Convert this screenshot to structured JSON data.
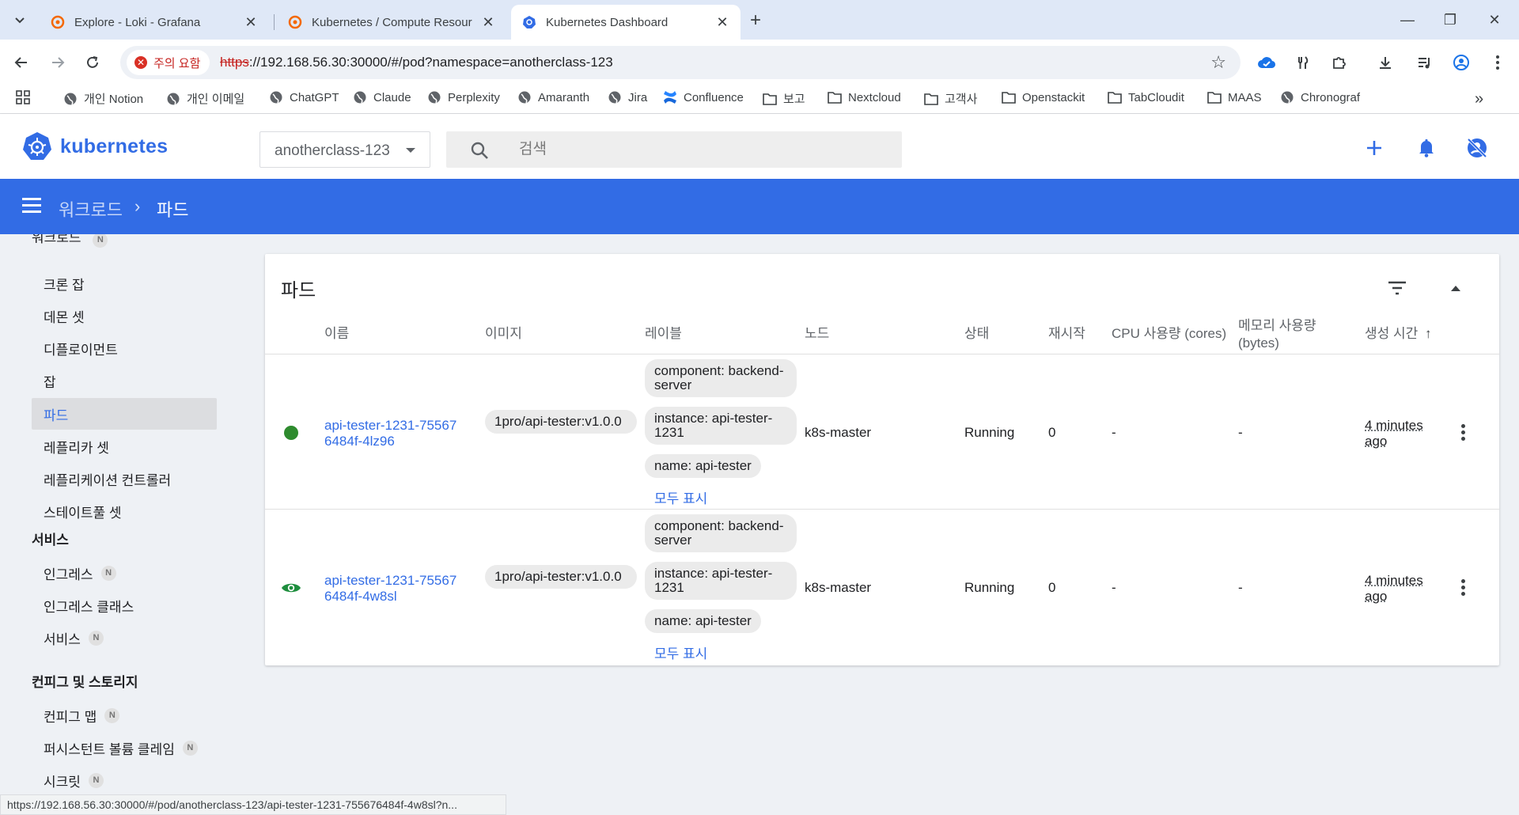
{
  "browser": {
    "tabs": [
      {
        "title": "Explore - Loki - Grafana",
        "active": false
      },
      {
        "title": "Kubernetes / Compute Resour",
        "active": false
      },
      {
        "title": "Kubernetes Dashboard",
        "active": true
      }
    ],
    "address": {
      "security_chip": "주의 요함",
      "url_scheme": "https",
      "url_rest": "://192.168.56.30:30000/#/pod?namespace=anotherclass-123"
    },
    "bookmarks": [
      {
        "label": "개인 Notion",
        "icon": "globe-icon"
      },
      {
        "label": "개인 이메일",
        "icon": "globe-icon"
      },
      {
        "label": "ChatGPT",
        "icon": "globe-icon"
      },
      {
        "label": "Claude",
        "icon": "globe-icon"
      },
      {
        "label": "Perplexity",
        "icon": "globe-icon"
      },
      {
        "label": "Amaranth",
        "icon": "globe-icon"
      },
      {
        "label": "Jira",
        "icon": "globe-icon"
      },
      {
        "label": "Confluence",
        "icon": "confluence-icon"
      },
      {
        "label": "보고",
        "icon": "folder-icon"
      },
      {
        "label": "Nextcloud",
        "icon": "folder-icon"
      },
      {
        "label": "고객사",
        "icon": "folder-icon"
      },
      {
        "label": "Openstackit",
        "icon": "folder-icon"
      },
      {
        "label": "TabCloudit",
        "icon": "folder-icon"
      },
      {
        "label": "MAAS",
        "icon": "folder-icon"
      },
      {
        "label": "Chronograf",
        "icon": "globe-icon"
      }
    ],
    "status_url": "https://192.168.56.30:30000/#/pod/anotherclass-123/api-tester-1231-755676484f-4w8sl?n..."
  },
  "header": {
    "logo_text": "kubernetes",
    "namespace": "anotherclass-123",
    "search_placeholder": "검색"
  },
  "breadcrumb": {
    "parent": "워크로드",
    "current": "파드"
  },
  "sidebar": {
    "workload_items": [
      {
        "label": "크론 잡",
        "active": false
      },
      {
        "label": "데몬 셋",
        "active": false
      },
      {
        "label": "디플로이먼트",
        "active": false
      },
      {
        "label": "잡",
        "active": false
      },
      {
        "label": "파드",
        "active": true
      },
      {
        "label": "레플리카 셋",
        "active": false
      },
      {
        "label": "레플리케이션 컨트롤러",
        "active": false
      },
      {
        "label": "스테이트풀 셋",
        "active": false
      }
    ],
    "service_heading": "서비스",
    "service_items": [
      {
        "label": "인그레스",
        "badge": "N"
      },
      {
        "label": "인그레스 클래스",
        "badge": ""
      },
      {
        "label": "서비스",
        "badge": "N"
      }
    ],
    "config_heading": "컨피그 및 스토리지",
    "config_items": [
      {
        "label": "컨피그 맵",
        "badge": "N"
      },
      {
        "label": "퍼시스턴트 볼륨 클레임",
        "badge": "N"
      },
      {
        "label": "시크릿",
        "badge": "N"
      }
    ]
  },
  "pods_card": {
    "title": "파드",
    "columns": {
      "name": "이름",
      "image": "이미지",
      "labels": "레이블",
      "node": "노드",
      "status": "상태",
      "restarts": "재시작",
      "cpu": "CPU 사용량 (cores)",
      "memory_line1": "메모리 사용량",
      "memory_line2": "(bytes)",
      "created": "생성 시간",
      "sort_arrow": "↑"
    },
    "show_all_label": "모두 표시",
    "rows": [
      {
        "status_icon": "running-dot-icon",
        "name": "api-tester-1231-755676484f-4lz96",
        "image": "1pro/api-tester:v1.0.0",
        "labels": [
          "component: backend-server",
          "instance: api-tester-1231",
          "name: api-tester"
        ],
        "node": "k8s-master",
        "status": "Running",
        "restarts": "0",
        "cpu": "-",
        "memory": "-",
        "age_line1": "4 minutes",
        "age_line2": "ago"
      },
      {
        "status_icon": "eye-icon",
        "name": "api-tester-1231-755676484f-4w8sl",
        "image": "1pro/api-tester:v1.0.0",
        "labels": [
          "component: backend-server",
          "instance: api-tester-1231",
          "name: api-tester"
        ],
        "node": "k8s-master",
        "status": "Running",
        "restarts": "0",
        "cpu": "-",
        "memory": "-",
        "age_line1": "4 minutes",
        "age_line2": "ago"
      }
    ]
  },
  "colors": {
    "k8s_blue": "#326ce5",
    "running_green": "#2e8b2e",
    "eye_green": "#1e8e3e"
  }
}
